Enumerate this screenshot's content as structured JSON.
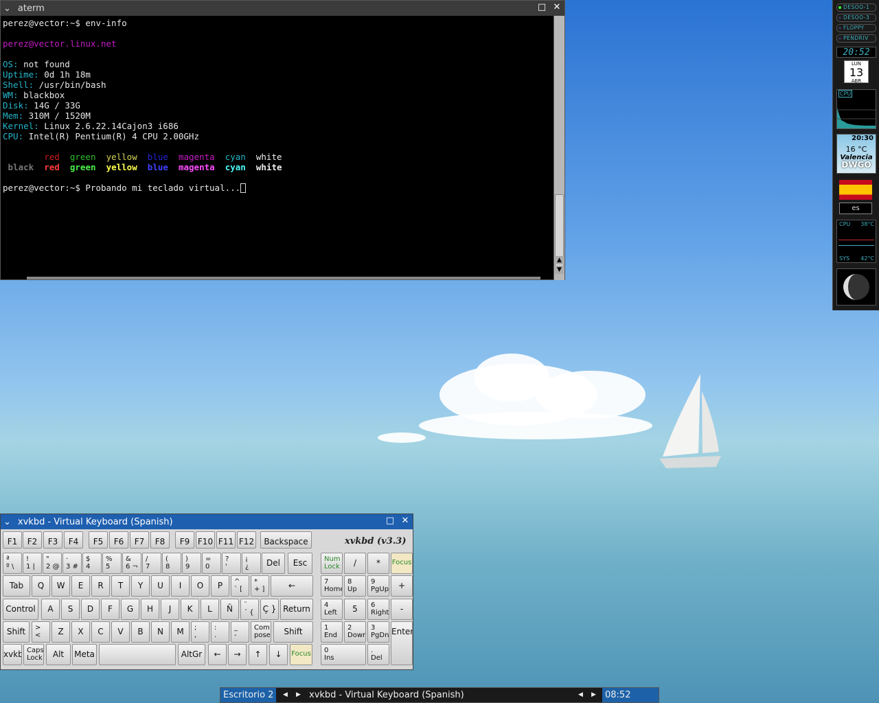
{
  "terminal": {
    "title": "aterm",
    "prompt1": "perez@vector:~$ env-info",
    "host": "perez@vector.linux.net",
    "info": [
      {
        "k": "OS:",
        "v": " not found"
      },
      {
        "k": "Uptime:",
        "v": " 0d 1h 18m"
      },
      {
        "k": "Shell:",
        "v": " /usr/bin/bash"
      },
      {
        "k": "WM:",
        "v": " blackbox"
      },
      {
        "k": "Disk:",
        "v": " 14G / 33G"
      },
      {
        "k": "Mem:",
        "v": " 310M / 1520M"
      },
      {
        "k": "Kernel:",
        "v": " Linux 2.6.22.14Cajon3 i686"
      },
      {
        "k": "CPU:",
        "v": " Intel(R) Pentium(R) 4 CPU 2.00GHz"
      }
    ],
    "colors": [
      "black",
      "red",
      "green",
      "yellow",
      "blue",
      "magenta",
      "cyan",
      "white"
    ],
    "prompt2": "perez@vector:~$ Probando mi teclado virtual..."
  },
  "dock": {
    "drives": [
      "DESOO-1",
      "DESOO-3",
      "FLOPPY",
      "PENDRIV"
    ],
    "clock": "20:52",
    "cal_day": "LUN",
    "cal_date": "13",
    "cal_month": "ABR",
    "cpu_label": "CPU",
    "weather_time": "20:30",
    "weather_temp": "16 °C",
    "weather_city": "Valencia",
    "weather_station": "DWGO",
    "lang": "es",
    "temp_cpu": "CPU",
    "temp_cpu_val": "38°C",
    "temp_sys": "SYS",
    "temp_sys_val": "42°C"
  },
  "keyboard": {
    "title": "xvkbd - Virtual Keyboard (Spanish)",
    "version": "xvkbd (v3.3)",
    "fkeys": [
      "F1",
      "F2",
      "F3",
      "F4",
      "F5",
      "F6",
      "F7",
      "F8",
      "F9",
      "F10",
      "F11",
      "F12",
      "Backspace"
    ],
    "row1": [
      "ª\nº \\",
      "!\n1 |",
      "\"\n2 @",
      "·\n3 #",
      "$\n4",
      "%\n5",
      "&\n6 ¬",
      "/\n7",
      "(\n8",
      ")\n9",
      "=\n0",
      "?\n'",
      "¡\n¿",
      "Del",
      "Esc"
    ],
    "row2": [
      "Tab",
      "Q",
      "W",
      "E",
      "R",
      "T",
      "Y",
      "U",
      "I",
      "O",
      "P",
      "^\n` [",
      "*\n+ ]",
      "←"
    ],
    "row3": [
      "Control",
      "A",
      "S",
      "D",
      "F",
      "G",
      "H",
      "J",
      "K",
      "L",
      "Ñ",
      "¨\n´ {",
      "Ç }",
      "Return"
    ],
    "row4": [
      "Shift",
      ">\n<",
      "Z",
      "X",
      "C",
      "V",
      "B",
      "N",
      "M",
      ";\n,",
      ":\n.",
      "_\n-",
      "Com\npose",
      "Shift"
    ],
    "row5": [
      "xvkbd",
      "Caps\nLock",
      "Alt",
      "Meta",
      "",
      "AltGr",
      "←",
      "→",
      "↑",
      "↓",
      "Focus"
    ],
    "numpad": [
      "Num\nLock",
      "/",
      "*",
      "Focus",
      "7\nHome",
      "8\nUp",
      "9\nPgUp",
      "+",
      "4\nLeft",
      "5",
      "6\nRight",
      "-",
      "1\nEnd",
      "2\nDown",
      "3\nPgDn",
      "Enter",
      "0\nIns",
      ".\nDel"
    ]
  },
  "taskbar": {
    "workspace": "Escritorio 2",
    "task": "xvkbd - Virtual Keyboard (Spanish)",
    "time": "08:52"
  }
}
